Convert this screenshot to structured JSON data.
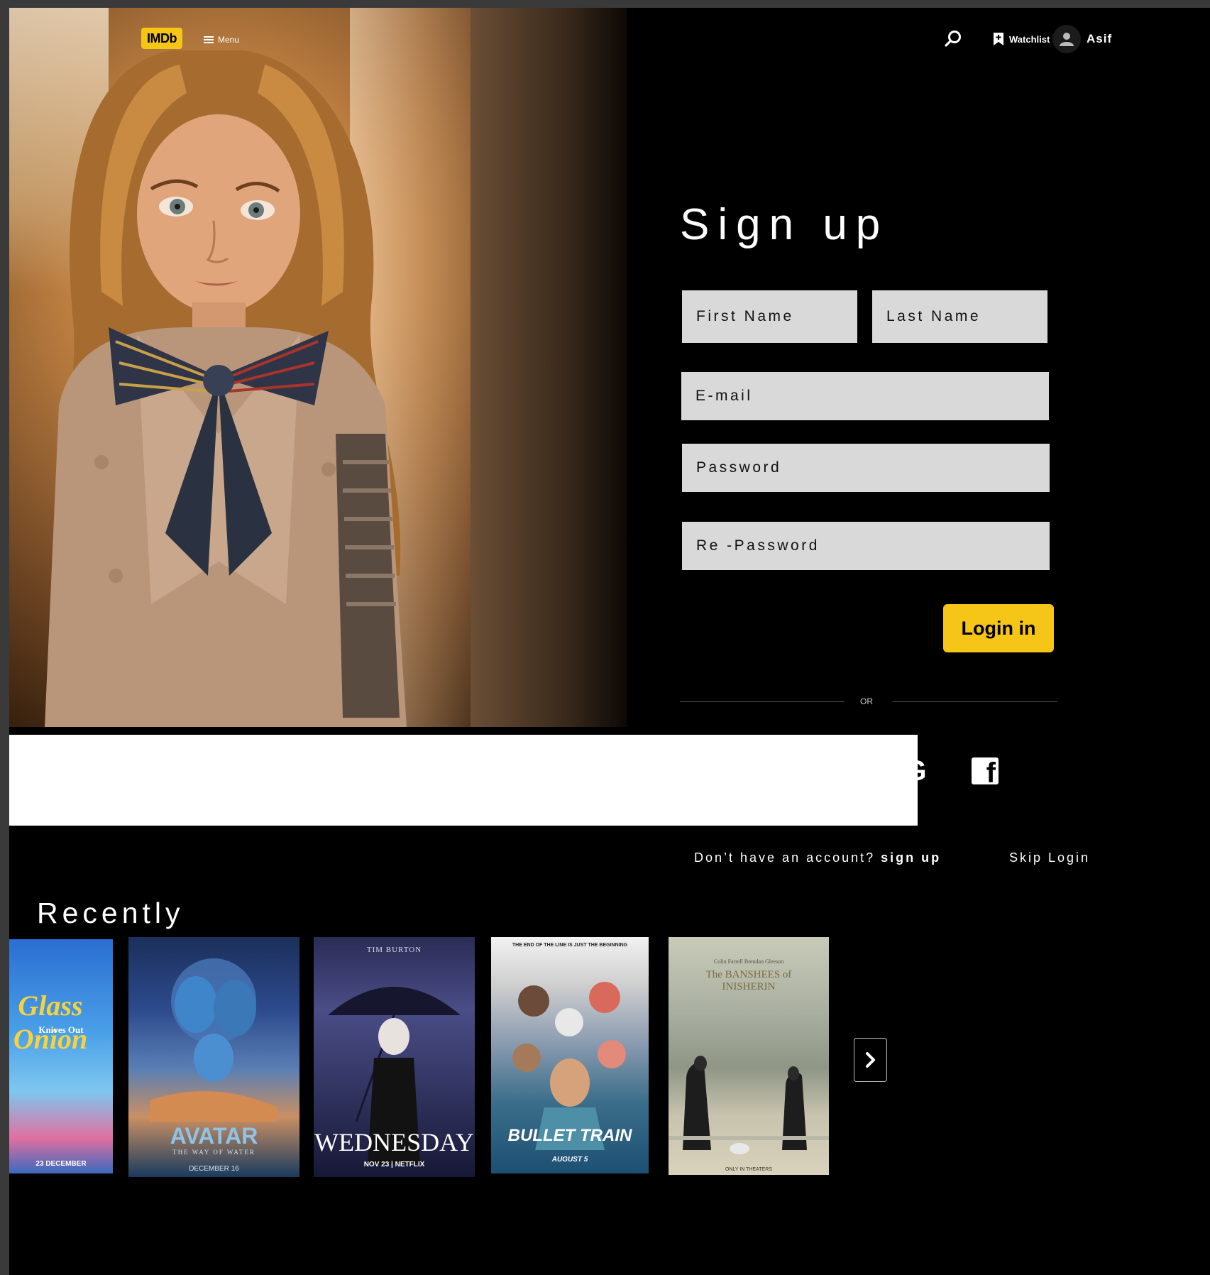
{
  "header": {
    "logo_text": "IMDb",
    "menu_label": "Menu",
    "watchlist_label": "Watchlist",
    "user_name": "Asif"
  },
  "form": {
    "title": "Sign up",
    "first_name_placeholder": "First Name",
    "last_name_placeholder": "Last Name",
    "email_placeholder": "E-mail",
    "password_placeholder": "Password",
    "repassword_placeholder": "Re -Password",
    "login_button": "Login in",
    "or_text": "OR",
    "no_account_prefix": "Don’t have an account?",
    "signup_link": "sign up",
    "skip_login": "Skip Login"
  },
  "social": {
    "google_icon": "google-icon",
    "facebook_icon": "facebook-icon"
  },
  "recently": {
    "title": "Recently",
    "posters": [
      {
        "title": "Glass Onion",
        "subtitle": "Knives Out",
        "bottom": "23 DECEMBER"
      },
      {
        "title": "AVATAR",
        "subtitle": "THE WAY OF WATER",
        "bottom": "DECEMBER 16"
      },
      {
        "title": "WEDNESDAY",
        "subtitle": "TIM BURTON",
        "bottom": "NOV 23 | NETFLIX"
      },
      {
        "title": "BULLET TRAIN",
        "subtitle": "THE END OF THE LINE IS JUST THE BEGINNING",
        "bottom": "AUGUST 5"
      },
      {
        "title": "The BANSHEES of INISHERIN",
        "subtitle": "Colin Farrell   Brendan Gleeson",
        "bottom": "ONLY IN THEATERS"
      }
    ]
  },
  "colors": {
    "accent": "#f5c518",
    "background": "#000000",
    "field": "#d9d9d9"
  }
}
